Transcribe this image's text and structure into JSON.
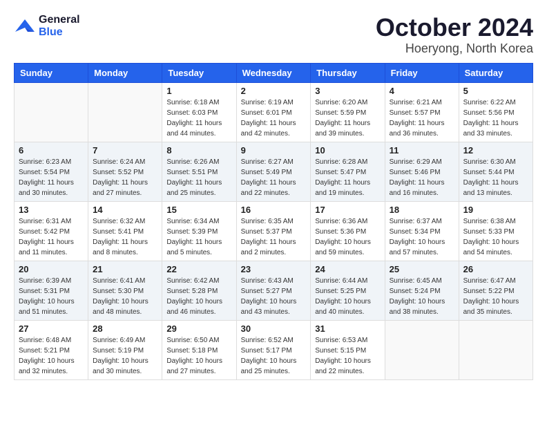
{
  "logo": {
    "line1": "General",
    "line2": "Blue"
  },
  "header": {
    "month": "October 2024",
    "location": "Hoeryong, North Korea"
  },
  "weekdays": [
    "Sunday",
    "Monday",
    "Tuesday",
    "Wednesday",
    "Thursday",
    "Friday",
    "Saturday"
  ],
  "weeks": [
    [
      {
        "day": "",
        "info": ""
      },
      {
        "day": "",
        "info": ""
      },
      {
        "day": "1",
        "info": "Sunrise: 6:18 AM\nSunset: 6:03 PM\nDaylight: 11 hours and 44 minutes."
      },
      {
        "day": "2",
        "info": "Sunrise: 6:19 AM\nSunset: 6:01 PM\nDaylight: 11 hours and 42 minutes."
      },
      {
        "day": "3",
        "info": "Sunrise: 6:20 AM\nSunset: 5:59 PM\nDaylight: 11 hours and 39 minutes."
      },
      {
        "day": "4",
        "info": "Sunrise: 6:21 AM\nSunset: 5:57 PM\nDaylight: 11 hours and 36 minutes."
      },
      {
        "day": "5",
        "info": "Sunrise: 6:22 AM\nSunset: 5:56 PM\nDaylight: 11 hours and 33 minutes."
      }
    ],
    [
      {
        "day": "6",
        "info": "Sunrise: 6:23 AM\nSunset: 5:54 PM\nDaylight: 11 hours and 30 minutes."
      },
      {
        "day": "7",
        "info": "Sunrise: 6:24 AM\nSunset: 5:52 PM\nDaylight: 11 hours and 27 minutes."
      },
      {
        "day": "8",
        "info": "Sunrise: 6:26 AM\nSunset: 5:51 PM\nDaylight: 11 hours and 25 minutes."
      },
      {
        "day": "9",
        "info": "Sunrise: 6:27 AM\nSunset: 5:49 PM\nDaylight: 11 hours and 22 minutes."
      },
      {
        "day": "10",
        "info": "Sunrise: 6:28 AM\nSunset: 5:47 PM\nDaylight: 11 hours and 19 minutes."
      },
      {
        "day": "11",
        "info": "Sunrise: 6:29 AM\nSunset: 5:46 PM\nDaylight: 11 hours and 16 minutes."
      },
      {
        "day": "12",
        "info": "Sunrise: 6:30 AM\nSunset: 5:44 PM\nDaylight: 11 hours and 13 minutes."
      }
    ],
    [
      {
        "day": "13",
        "info": "Sunrise: 6:31 AM\nSunset: 5:42 PM\nDaylight: 11 hours and 11 minutes."
      },
      {
        "day": "14",
        "info": "Sunrise: 6:32 AM\nSunset: 5:41 PM\nDaylight: 11 hours and 8 minutes."
      },
      {
        "day": "15",
        "info": "Sunrise: 6:34 AM\nSunset: 5:39 PM\nDaylight: 11 hours and 5 minutes."
      },
      {
        "day": "16",
        "info": "Sunrise: 6:35 AM\nSunset: 5:37 PM\nDaylight: 11 hours and 2 minutes."
      },
      {
        "day": "17",
        "info": "Sunrise: 6:36 AM\nSunset: 5:36 PM\nDaylight: 10 hours and 59 minutes."
      },
      {
        "day": "18",
        "info": "Sunrise: 6:37 AM\nSunset: 5:34 PM\nDaylight: 10 hours and 57 minutes."
      },
      {
        "day": "19",
        "info": "Sunrise: 6:38 AM\nSunset: 5:33 PM\nDaylight: 10 hours and 54 minutes."
      }
    ],
    [
      {
        "day": "20",
        "info": "Sunrise: 6:39 AM\nSunset: 5:31 PM\nDaylight: 10 hours and 51 minutes."
      },
      {
        "day": "21",
        "info": "Sunrise: 6:41 AM\nSunset: 5:30 PM\nDaylight: 10 hours and 48 minutes."
      },
      {
        "day": "22",
        "info": "Sunrise: 6:42 AM\nSunset: 5:28 PM\nDaylight: 10 hours and 46 minutes."
      },
      {
        "day": "23",
        "info": "Sunrise: 6:43 AM\nSunset: 5:27 PM\nDaylight: 10 hours and 43 minutes."
      },
      {
        "day": "24",
        "info": "Sunrise: 6:44 AM\nSunset: 5:25 PM\nDaylight: 10 hours and 40 minutes."
      },
      {
        "day": "25",
        "info": "Sunrise: 6:45 AM\nSunset: 5:24 PM\nDaylight: 10 hours and 38 minutes."
      },
      {
        "day": "26",
        "info": "Sunrise: 6:47 AM\nSunset: 5:22 PM\nDaylight: 10 hours and 35 minutes."
      }
    ],
    [
      {
        "day": "27",
        "info": "Sunrise: 6:48 AM\nSunset: 5:21 PM\nDaylight: 10 hours and 32 minutes."
      },
      {
        "day": "28",
        "info": "Sunrise: 6:49 AM\nSunset: 5:19 PM\nDaylight: 10 hours and 30 minutes."
      },
      {
        "day": "29",
        "info": "Sunrise: 6:50 AM\nSunset: 5:18 PM\nDaylight: 10 hours and 27 minutes."
      },
      {
        "day": "30",
        "info": "Sunrise: 6:52 AM\nSunset: 5:17 PM\nDaylight: 10 hours and 25 minutes."
      },
      {
        "day": "31",
        "info": "Sunrise: 6:53 AM\nSunset: 5:15 PM\nDaylight: 10 hours and 22 minutes."
      },
      {
        "day": "",
        "info": ""
      },
      {
        "day": "",
        "info": ""
      }
    ]
  ]
}
